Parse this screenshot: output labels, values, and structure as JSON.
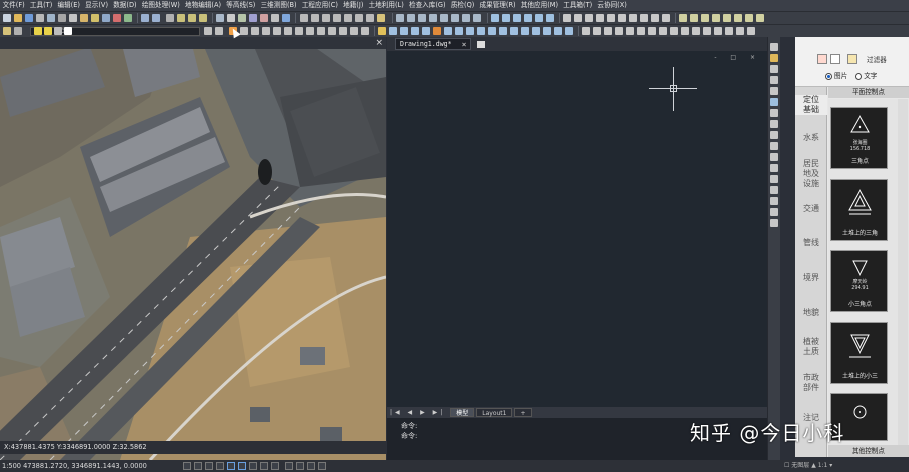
{
  "menu": [
    "文件(F)",
    "工具(T)",
    "编辑(E)",
    "显示(V)",
    "数据(D)",
    "绘图处理(W)",
    "地物编辑(A)",
    "等高线(S)",
    "三维测图(B)",
    "工程应用(C)",
    "地籍(J)",
    "土地利用(L)",
    "检查入库(G)",
    "质检(Q)",
    "成果管理(R)",
    "其他应用(M)",
    "工具箱(T)",
    "云协同(X)"
  ],
  "layer": {
    "value": "0"
  },
  "left_view": {
    "close_label": "×"
  },
  "coords": {
    "readout": "X:437881.4375  Y:3346891.0000  Z:32.5862"
  },
  "drawing": {
    "tab_title": "Drawing1.dwg*",
    "tab_close": "×",
    "window_controls": "- □ ×",
    "layout_tabs": [
      "模型",
      "Layout1",
      "+"
    ],
    "nav": "|◀ ◀ ▶ ▶|",
    "command_lines": [
      "命令:",
      "命令:"
    ]
  },
  "panel": {
    "filter_label": "过滤器",
    "radio_options": [
      {
        "label": "图片",
        "selected": true
      },
      {
        "label": "文字",
        "selected": false
      }
    ],
    "section_title": "平面控制点",
    "footer_title": "其他控制点",
    "categories": [
      "定位基础",
      "水系",
      "居民地及设施",
      "交通",
      "管线",
      "境界",
      "地貌",
      "植被土质",
      "市政部件",
      "注记"
    ],
    "symbols": [
      {
        "label": "三角点",
        "subtitle": [
          "张海圈",
          "156.718"
        ]
      },
      {
        "label": "土堆上的三角",
        "subtitle": []
      },
      {
        "label": "小三角点",
        "subtitle": [
          "摩天岭",
          "294.91"
        ]
      },
      {
        "label": "土堆上的小三",
        "subtitle": []
      },
      {
        "label": "",
        "subtitle": []
      }
    ]
  },
  "status": {
    "left": "1:500  473881.2720, 3346891.1443, 0.0000",
    "right": "☐ 无图层  ▲ 1:1 ▾"
  },
  "watermark": "知乎 @今日小科",
  "colors": {
    "app_bg": "#2b2f38",
    "drawing_bg": "#212830",
    "panel_bg": "#e7e7e7",
    "symbol_bg": "#202020",
    "accent": "#1a5fc2"
  }
}
